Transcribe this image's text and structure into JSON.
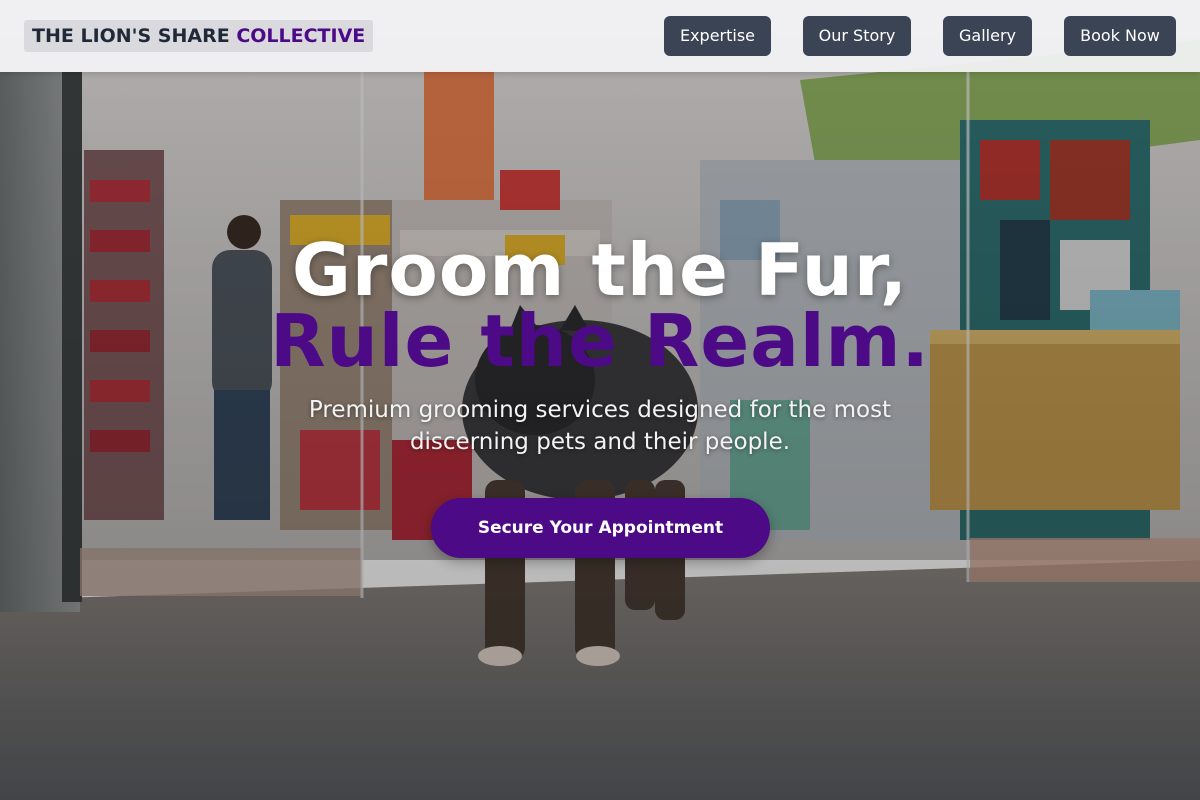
{
  "header": {
    "logo_main": "THE LION'S SHARE",
    "logo_accent": "COLLECTIVE",
    "nav": [
      {
        "label": "Expertise"
      },
      {
        "label": "Our Story"
      },
      {
        "label": "Gallery"
      },
      {
        "label": "Book Now"
      }
    ]
  },
  "hero": {
    "headline_line1": "Groom the Fur,",
    "headline_line2": "Rule the Realm.",
    "subtitle": "Premium grooming services designed for the most discerning pets and their people.",
    "cta_label": "Secure Your Appointment",
    "background_image": "pet store aisle with a small dog in a jacket"
  },
  "colors": {
    "brand_accent": "#4c0a87",
    "nav_button_bg": "#3a4455",
    "header_bg": "#f4f4f6"
  }
}
